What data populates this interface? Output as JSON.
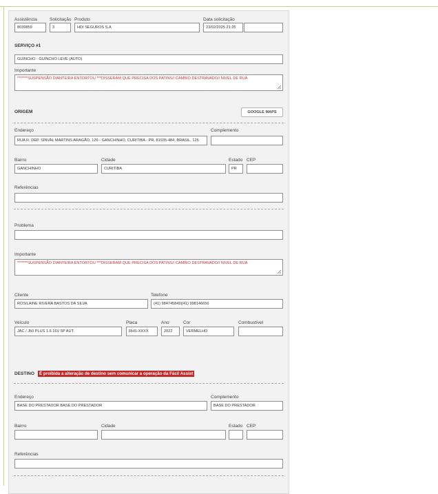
{
  "header": {
    "assistencia_label": "Assistência",
    "assistencia_value": "8039859",
    "solicitacao_label": "Solicitação",
    "solicitacao_value": "3",
    "produto_label": "Produto",
    "produto_value": "HDI SEGUROS S.A",
    "data_label": "Data solicitação",
    "data_value": "23/02/2025 21:25",
    "data_extra": ""
  },
  "servico": {
    "title": "SERVIÇO #1",
    "tipo_value": "GUINCHO - GUINCHO LEVE (AUTO)",
    "importante_label": "Importante",
    "importante_value": "*******SUSPENSÃO DIANTEIRA ENTORTOU ***DISSERAM QUE PRECISA DOS PATINS// CAMBIO DESTRAVADO// NIVEL DE RUA"
  },
  "origem": {
    "title": "ORIGEM",
    "maps_button": "GOOGLE MAPS",
    "endereco_label": "Endereço",
    "endereco_value": "RUA R. DEP. SÍNVAL MARTINS ARAGÃO, 126 - GANCHINHO, CURITIBA - PR, 81935-484, BRASIL, 126",
    "complemento_label": "Complemento",
    "complemento_value": "",
    "bairro_label": "Bairro",
    "bairro_value": "GANCHINHO",
    "cidade_label": "Cidade",
    "cidade_value": "CURITIBA",
    "estado_label": "Estado",
    "estado_value": "PR",
    "cep_label": "CEP",
    "cep_value": "",
    "referencias_label": "Referências",
    "referencias_value": ""
  },
  "problema": {
    "problema_label": "Problema",
    "problema_value": "",
    "importante_label": "Importante",
    "importante_value": "*******SUSPENSÃO DIANTEIRA ENTORTOU ***DISSERAM QUE PRECISA DOS PATINS// CAMBIO DESTRAVADO// NIVEL DE RUA",
    "cliente_label": "Cliente",
    "cliente_value": "ROSILAINE RIVERA BASTOS DA SILVA",
    "telefone_label": "Telefone",
    "telefone_value": "(41) 984745849|(41) 998146656",
    "veiculo_label": "Veículo",
    "veiculo_value": "JAC / J50 PLUS 1.6 16V 5P AUT.",
    "placa_label": "Placa",
    "placa_value": "RHS-XXXX",
    "ano_label": "Ano",
    "ano_value": "2022",
    "cor_label": "Cor",
    "cor_value": "VERMELHO",
    "combustivel_label": "Combustível",
    "combustivel_value": ""
  },
  "destino": {
    "title": "DESTINO",
    "warning": "É proibida a alteração de destino sem comunicar a operação da Fácil Assist",
    "endereco_label": "Endereço",
    "endereco_value": "BASE DO PRESTADOR BASE DO PRESTADOR",
    "complemento_label": "Complemento",
    "complemento_value": "BASE DO PRESTADOR",
    "bairro_label": "Bairro",
    "bairro_value": "",
    "cidade_label": "Cidade",
    "cidade_value": "",
    "estado_label": "Estado",
    "estado_value": "",
    "cep_label": "CEP",
    "cep_value": "",
    "referencias_label": "Referências",
    "referencias_value": ""
  },
  "colors": {
    "accent_red": "#d32f2f",
    "warning_bg": "#c62828",
    "panel_bg": "#f2f2f2",
    "frame_line": "#c9d48a"
  },
  "icons": {
    "resize_grip": "resize-grip-icon"
  }
}
